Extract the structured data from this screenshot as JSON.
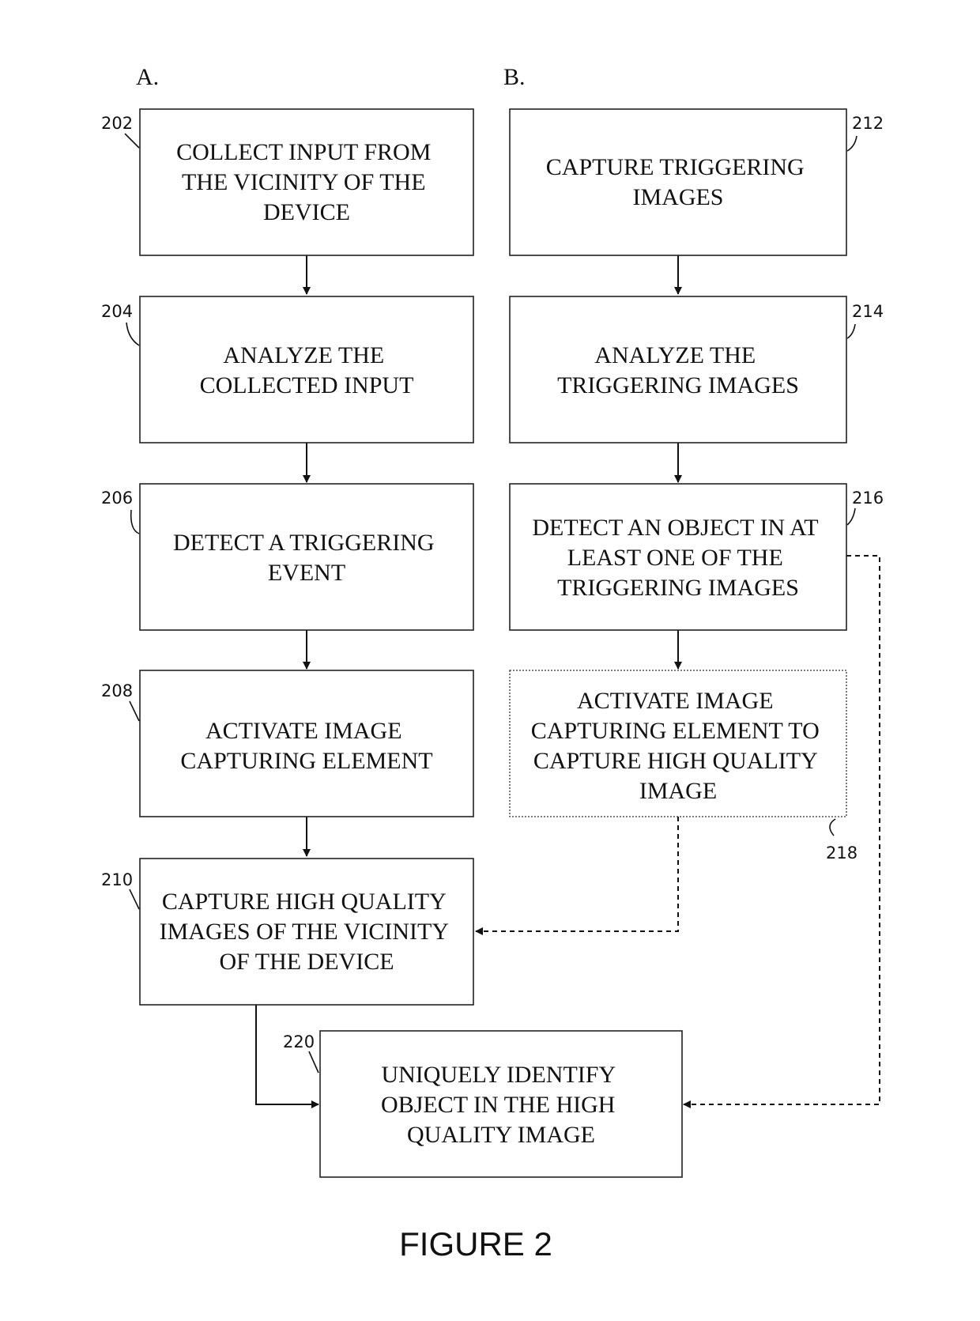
{
  "figure_title": "FIGURE 2",
  "columns": {
    "a": "A.",
    "b": "B."
  },
  "boxes": {
    "b202": {
      "ref": "202",
      "lines": [
        "COLLECT INPUT FROM",
        "THE VICINITY OF THE",
        "DEVICE"
      ]
    },
    "b204": {
      "ref": "204",
      "lines": [
        "ANALYZE THE",
        "COLLECTED INPUT"
      ]
    },
    "b206": {
      "ref": "206",
      "lines": [
        "DETECT A TRIGGERING",
        "EVENT"
      ]
    },
    "b208": {
      "ref": "208",
      "lines": [
        "ACTIVATE IMAGE",
        "CAPTURING ELEMENT"
      ]
    },
    "b210": {
      "ref": "210",
      "lines": [
        "CAPTURE HIGH QUALITY",
        "IMAGES OF THE VICINITY",
        "OF THE DEVICE"
      ]
    },
    "b212": {
      "ref": "212",
      "lines": [
        "CAPTURE TRIGGERING",
        "IMAGES"
      ]
    },
    "b214": {
      "ref": "214",
      "lines": [
        "ANALYZE THE",
        "TRIGGERING IMAGES"
      ]
    },
    "b216": {
      "ref": "216",
      "lines": [
        "DETECT AN OBJECT IN AT",
        "LEAST ONE OF THE",
        "TRIGGERING IMAGES"
      ]
    },
    "b218": {
      "ref": "218",
      "lines": [
        "ACTIVATE IMAGE",
        "CAPTURING ELEMENT TO",
        "CAPTURE HIGH QUALITY",
        "IMAGE"
      ],
      "optional": true
    },
    "b220": {
      "ref": "220",
      "lines": [
        "UNIQUELY IDENTIFY",
        "OBJECT IN THE HIGH",
        "QUALITY IMAGE"
      ]
    }
  },
  "connections": [
    {
      "from": "202",
      "to": "204",
      "style": "solid"
    },
    {
      "from": "204",
      "to": "206",
      "style": "solid"
    },
    {
      "from": "206",
      "to": "208",
      "style": "solid"
    },
    {
      "from": "208",
      "to": "210",
      "style": "solid"
    },
    {
      "from": "210",
      "to": "220",
      "style": "solid"
    },
    {
      "from": "212",
      "to": "214",
      "style": "solid"
    },
    {
      "from": "214",
      "to": "216",
      "style": "solid"
    },
    {
      "from": "216",
      "to": "218",
      "style": "solid"
    },
    {
      "from": "218",
      "to": "210",
      "style": "dashed"
    },
    {
      "from": "216",
      "to": "220",
      "style": "dashed"
    }
  ]
}
